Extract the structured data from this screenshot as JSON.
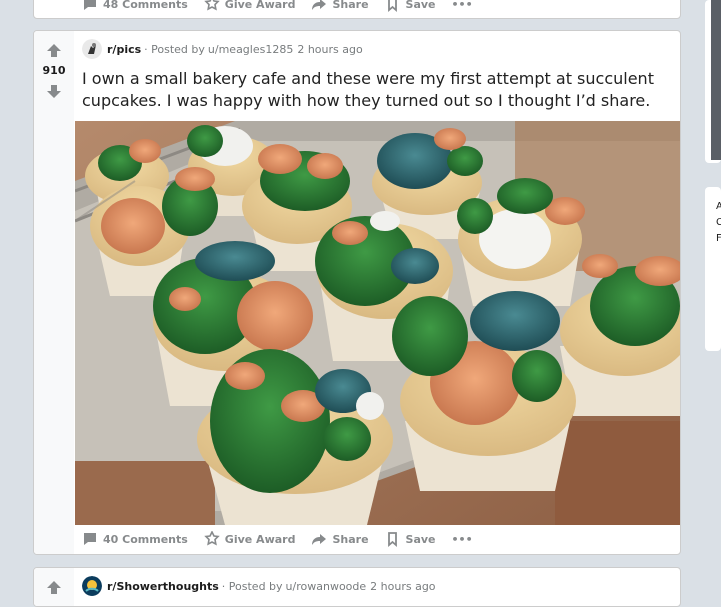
{
  "prev_post": {
    "comments_label": "48 Comments",
    "award_label": "Give Award",
    "share_label": "Share",
    "save_label": "Save",
    "more_label": "•••"
  },
  "post": {
    "score": "910",
    "subreddit": "r/pics",
    "posted_by_prefix": "· Posted by",
    "author": "u/meagles1285",
    "time": "2 hours ago",
    "title": "I own a small bakery cafe and these were my first attempt at succulent cupcakes. I was happy with how they turned out so I thought I’d share.",
    "image_icon": "succulent-cupcakes-photo",
    "comments_label": "40 Comments",
    "award_label": "Give Award",
    "share_label": "Share",
    "save_label": "Save",
    "more_label": "•••"
  },
  "next_post": {
    "subreddit": "r/Showerthoughts",
    "posted_by_prefix": "· Posted by",
    "author": "u/rowanwoode",
    "time": "2 hours ago"
  },
  "sidebar": {
    "text_fragments": [
      "A",
      "C",
      "F"
    ]
  },
  "colors": {
    "page_bg": "#dae0e6",
    "card_bg": "#ffffff",
    "vote_bg": "#f8f9fa",
    "meta_text": "#787c7e",
    "action_text": "#878a8c"
  }
}
